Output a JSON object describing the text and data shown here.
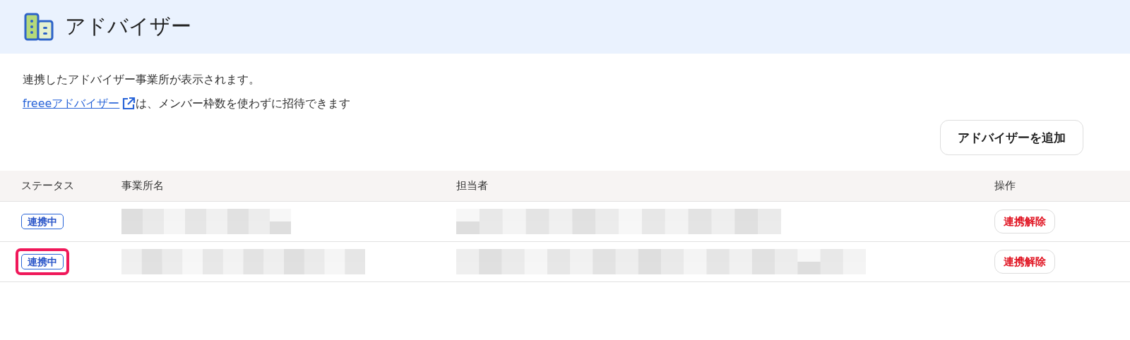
{
  "header": {
    "title": "アドバイザー"
  },
  "description": {
    "line_1": "連携したアドバイザー事業所が表示されます。",
    "link": "freeeアドバイザー",
    "line_2_rest": "は、メンバー枠数を使わずに招待できます"
  },
  "add_button": "アドバイザーを追加",
  "table": {
    "columns": [
      "ステータス",
      "事業所名",
      "担当者",
      "操作"
    ],
    "rows": [
      {
        "status": "連携中",
        "action": "連携解除",
        "highlighted": false
      },
      {
        "status": "連携中",
        "action": "連携解除",
        "highlighted": true
      }
    ]
  }
}
